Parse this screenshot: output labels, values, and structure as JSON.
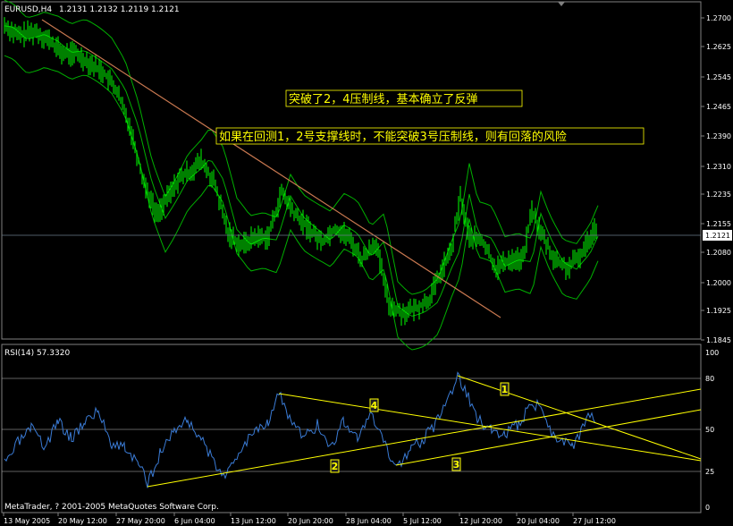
{
  "window": {
    "symbol_header": "EURUSD,H4",
    "ohlc": "1.2131 1.2132 1.2119 1.2121",
    "current_price": "1.2121"
  },
  "price_axis": {
    "labels": [
      "1.2700",
      "1.2625",
      "1.2545",
      "1.2465",
      "1.2390",
      "1.2310",
      "1.2235",
      "1.2155",
      "1.2080",
      "1.2000",
      "1.1925",
      "1.1845"
    ]
  },
  "indicator": {
    "header": "RSI(14) 57.3320",
    "axis_labels": [
      "100",
      "80",
      "50",
      "25",
      "0"
    ]
  },
  "time_axis": {
    "labels": [
      "13 May 2005",
      "20 May 12:00",
      "27 May 20:00",
      "6 Jun 04:00",
      "13 Jun 12:00",
      "20 Jun 20:00",
      "28 Jun 04:00",
      "5 Jul 12:00",
      "12 Jul 20:00",
      "20 Jul 04:00",
      "27 Jul 12:00"
    ]
  },
  "copyright": "MetaTrader, ? 2001-2005 MetaQuotes Software Corp.",
  "annotations": {
    "note1": "突破了2，4压制线，基本确立了反弹",
    "note2": "如果在回测1，2号支撑线时，不能突破3号压制线，则有回落的风险",
    "markers": [
      "1",
      "2",
      "3",
      "4"
    ]
  },
  "colors": {
    "background": "#000000",
    "candles": "#00ff00",
    "bands": "#00c000",
    "trendline": "#c87850",
    "rsi": "#3a7bd5",
    "rsi_trendlines": "#ffff00",
    "note_text": "#ffff00",
    "grid": "#404040"
  }
}
